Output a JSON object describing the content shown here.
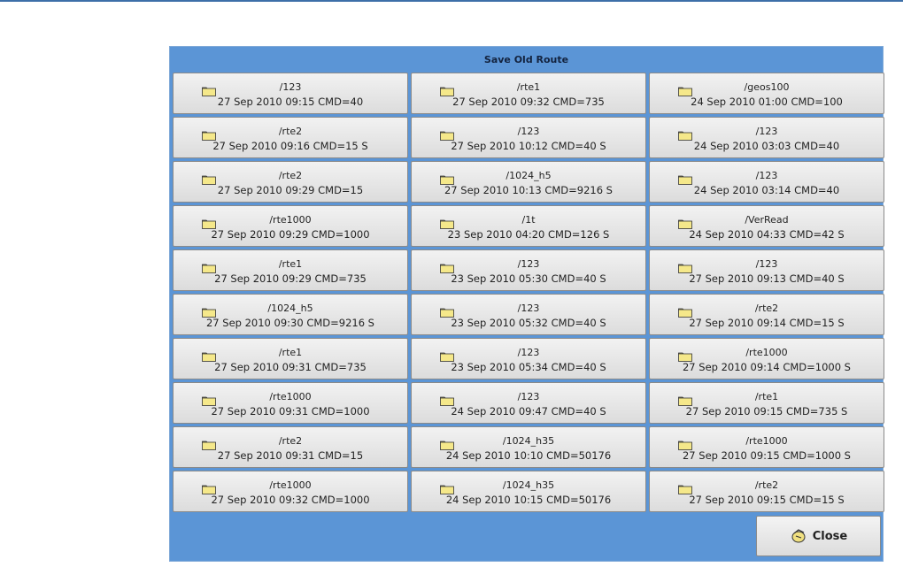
{
  "dialog": {
    "title": "Save Old Route",
    "close_label": "Close"
  },
  "routes": [
    {
      "name": "/123",
      "info": "27 Sep 2010 09:15 CMD=40"
    },
    {
      "name": "/rte1",
      "info": "27 Sep 2010 09:32 CMD=735"
    },
    {
      "name": "/geos100",
      "info": "24 Sep 2010 01:00 CMD=100"
    },
    {
      "name": "/rte2",
      "info": "27 Sep 2010 09:16 CMD=15  S"
    },
    {
      "name": "/123",
      "info": "27 Sep 2010 10:12 CMD=40  S"
    },
    {
      "name": "/123",
      "info": "24 Sep 2010 03:03 CMD=40"
    },
    {
      "name": "/rte2",
      "info": "27 Sep 2010 09:29 CMD=15"
    },
    {
      "name": "/1024_h5",
      "info": "27 Sep 2010 10:13 CMD=9216  S"
    },
    {
      "name": "/123",
      "info": "24 Sep 2010 03:14 CMD=40"
    },
    {
      "name": "/rte1000",
      "info": "27 Sep 2010 09:29 CMD=1000"
    },
    {
      "name": "/1t",
      "info": "23 Sep 2010 04:20 CMD=126  S"
    },
    {
      "name": "/VerRead",
      "info": "24 Sep 2010 04:33 CMD=42  S"
    },
    {
      "name": "/rte1",
      "info": "27 Sep 2010 09:29 CMD=735"
    },
    {
      "name": "/123",
      "info": "23 Sep 2010 05:30 CMD=40  S"
    },
    {
      "name": "/123",
      "info": "27 Sep 2010 09:13 CMD=40  S"
    },
    {
      "name": "/1024_h5",
      "info": "27 Sep 2010 09:30 CMD=9216  S"
    },
    {
      "name": "/123",
      "info": "23 Sep 2010 05:32 CMD=40  S"
    },
    {
      "name": "/rte2",
      "info": "27 Sep 2010 09:14 CMD=15  S"
    },
    {
      "name": "/rte1",
      "info": "27 Sep 2010 09:31 CMD=735"
    },
    {
      "name": "/123",
      "info": "23 Sep 2010 05:34 CMD=40  S"
    },
    {
      "name": "/rte1000",
      "info": "27 Sep 2010 09:14 CMD=1000  S"
    },
    {
      "name": "/rte1000",
      "info": "27 Sep 2010 09:31 CMD=1000"
    },
    {
      "name": "/123",
      "info": "24 Sep 2010 09:47 CMD=40  S"
    },
    {
      "name": "/rte1",
      "info": "27 Sep 2010 09:15 CMD=735  S"
    },
    {
      "name": "/rte2",
      "info": "27 Sep 2010 09:31 CMD=15"
    },
    {
      "name": "/1024_h35",
      "info": "24 Sep 2010 10:10 CMD=50176"
    },
    {
      "name": "/rte1000",
      "info": "27 Sep 2010 09:15 CMD=1000  S"
    },
    {
      "name": "/rte1000",
      "info": "27 Sep 2010 09:32 CMD=1000"
    },
    {
      "name": "/1024_h35",
      "info": "24 Sep 2010 10:15 CMD=50176"
    },
    {
      "name": "/rte2",
      "info": "27 Sep 2010 09:15 CMD=15  S"
    }
  ],
  "colors": {
    "dialog_bg": "#5b95d6",
    "button_bg": "#e6e6e6",
    "folder_fill": "#f5e88a"
  },
  "icons": {
    "route_icon": "folder-icon",
    "close_icon": "close-icon"
  }
}
